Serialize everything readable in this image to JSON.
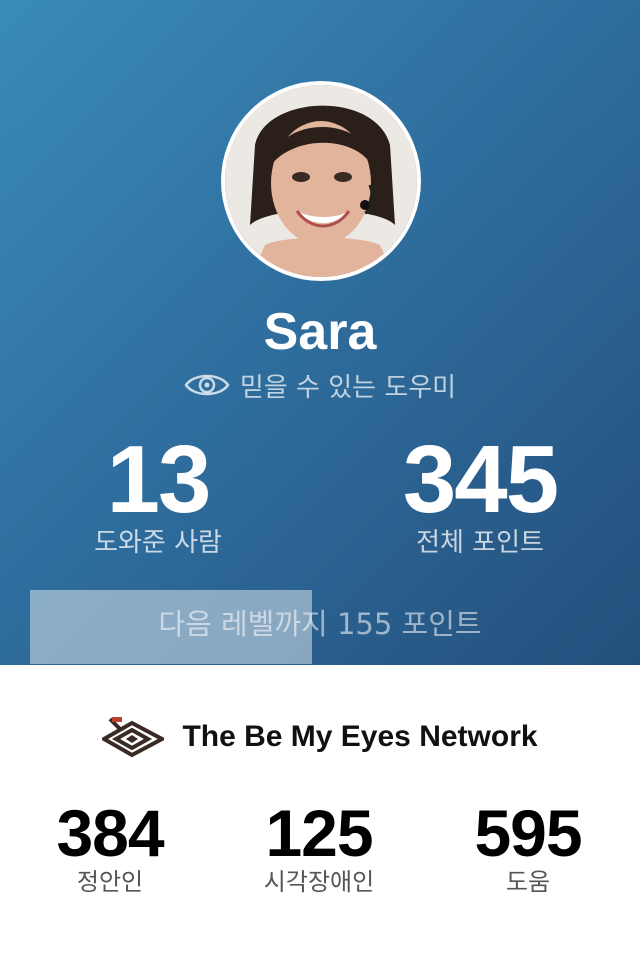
{
  "profile": {
    "name": "Sara",
    "role": "믿을 수 있는 도우미",
    "role_icon": "eye-icon"
  },
  "stats": {
    "helped_value": "13",
    "helped_label": "도와준 사람",
    "points_value": "345",
    "points_label": "전체 포인트"
  },
  "progress": {
    "text": "다음 레벨까지 155 포인트",
    "fraction": 0.47
  },
  "network": {
    "title": "The Be My Eyes Network",
    "logo_icon": "be-my-eyes-logo-icon",
    "stats": [
      {
        "value": "384",
        "label": "정안인"
      },
      {
        "value": "125",
        "label": "시각장애인"
      },
      {
        "value": "595",
        "label": "도움"
      }
    ]
  },
  "colors": {
    "hero_start": "#3a8bb8",
    "hero_end": "#244f7c",
    "network_bg": "#ffffff"
  }
}
